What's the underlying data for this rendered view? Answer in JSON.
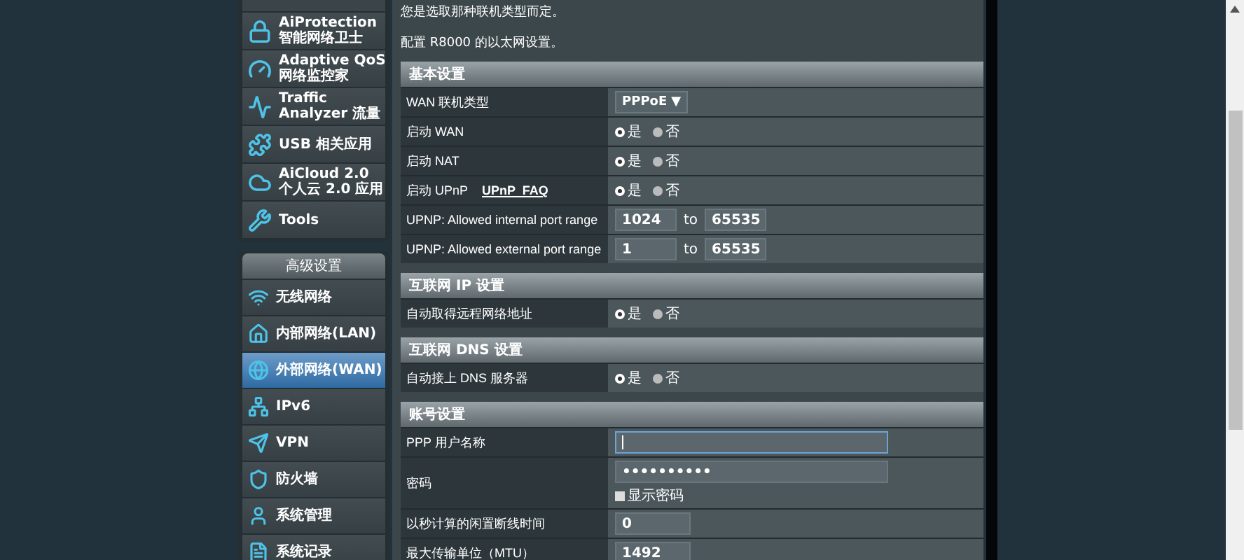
{
  "sidebar": {
    "general_items": [
      {
        "label": "AiProtection",
        "sublabel": "智能网络卫士"
      },
      {
        "label": "Adaptive QoS",
        "sublabel": "网络监控家"
      },
      {
        "label": "Traffic",
        "sublabel": "Analyzer 流量"
      },
      {
        "label": "USB 相关应用"
      },
      {
        "label": "AiCloud 2.0",
        "sublabel": "个人云 2.0 应用"
      },
      {
        "label": "Tools"
      }
    ],
    "advanced": {
      "title": "高级设置",
      "items": [
        {
          "label": "无线网络",
          "selected": false
        },
        {
          "label": "内部网络(LAN)",
          "selected": false
        },
        {
          "label": "外部网络(WAN)",
          "selected": true
        },
        {
          "label": "IPv6",
          "selected": false
        },
        {
          "label": "VPN",
          "selected": false
        },
        {
          "label": "防火墙",
          "selected": false
        },
        {
          "label": "系统管理",
          "selected": false
        },
        {
          "label": "系统记录",
          "selected": false
        }
      ]
    }
  },
  "content": {
    "intro": [
      "您是选取那种联机类型而定。",
      "配置 R8000 的以太网设置。"
    ],
    "sections": [
      {
        "title": "基本设置",
        "rows": [
          {
            "kind": "select",
            "label": "WAN 联机类型",
            "value": "PPPoE",
            "arrow": "▼"
          },
          {
            "kind": "radio",
            "label": "启动 WAN",
            "options": [
              {
                "label": "是",
                "selected": true
              },
              {
                "label": "否",
                "selected": false
              }
            ]
          },
          {
            "kind": "radio",
            "label": "启动 NAT",
            "options": [
              {
                "label": "是",
                "selected": true
              },
              {
                "label": "否",
                "selected": false
              }
            ]
          },
          {
            "kind": "radio",
            "label": "启动 UPnP",
            "link": "UPnP  FAQ",
            "options": [
              {
                "label": "是",
                "selected": true
              },
              {
                "label": "否",
                "selected": false
              }
            ]
          },
          {
            "kind": "range",
            "label": "UPNP: Allowed internal port range",
            "from": "1024",
            "sep": "to",
            "to": "65535"
          },
          {
            "kind": "range",
            "label": "UPNP: Allowed external port range",
            "from": "1",
            "sep": "to",
            "to": "65535"
          }
        ]
      },
      {
        "title": "互联网 IP 设置",
        "rows": [
          {
            "kind": "radio",
            "label": "自动取得远程网络地址",
            "options": [
              {
                "label": "是",
                "selected": true
              },
              {
                "label": "否",
                "selected": false
              }
            ]
          }
        ]
      },
      {
        "title": "互联网 DNS 设置",
        "rows": [
          {
            "kind": "radio",
            "label": "自动接上 DNS 服务器",
            "options": [
              {
                "label": "是",
                "selected": true
              },
              {
                "label": "否",
                "selected": false
              }
            ]
          }
        ]
      },
      {
        "title": "账号设置",
        "rows": [
          {
            "kind": "text",
            "label": "PPP 用户名称",
            "value": "",
            "focused": true
          },
          {
            "kind": "password",
            "label": "密码",
            "value": "••••••••••",
            "show_label": "显示密码",
            "show_checked": false
          },
          {
            "kind": "short",
            "label": "以秒计算的闲置断线时间",
            "value": "0"
          },
          {
            "kind": "short",
            "label": "最大传输单位（MTU）",
            "value": "1492"
          }
        ]
      }
    ]
  }
}
